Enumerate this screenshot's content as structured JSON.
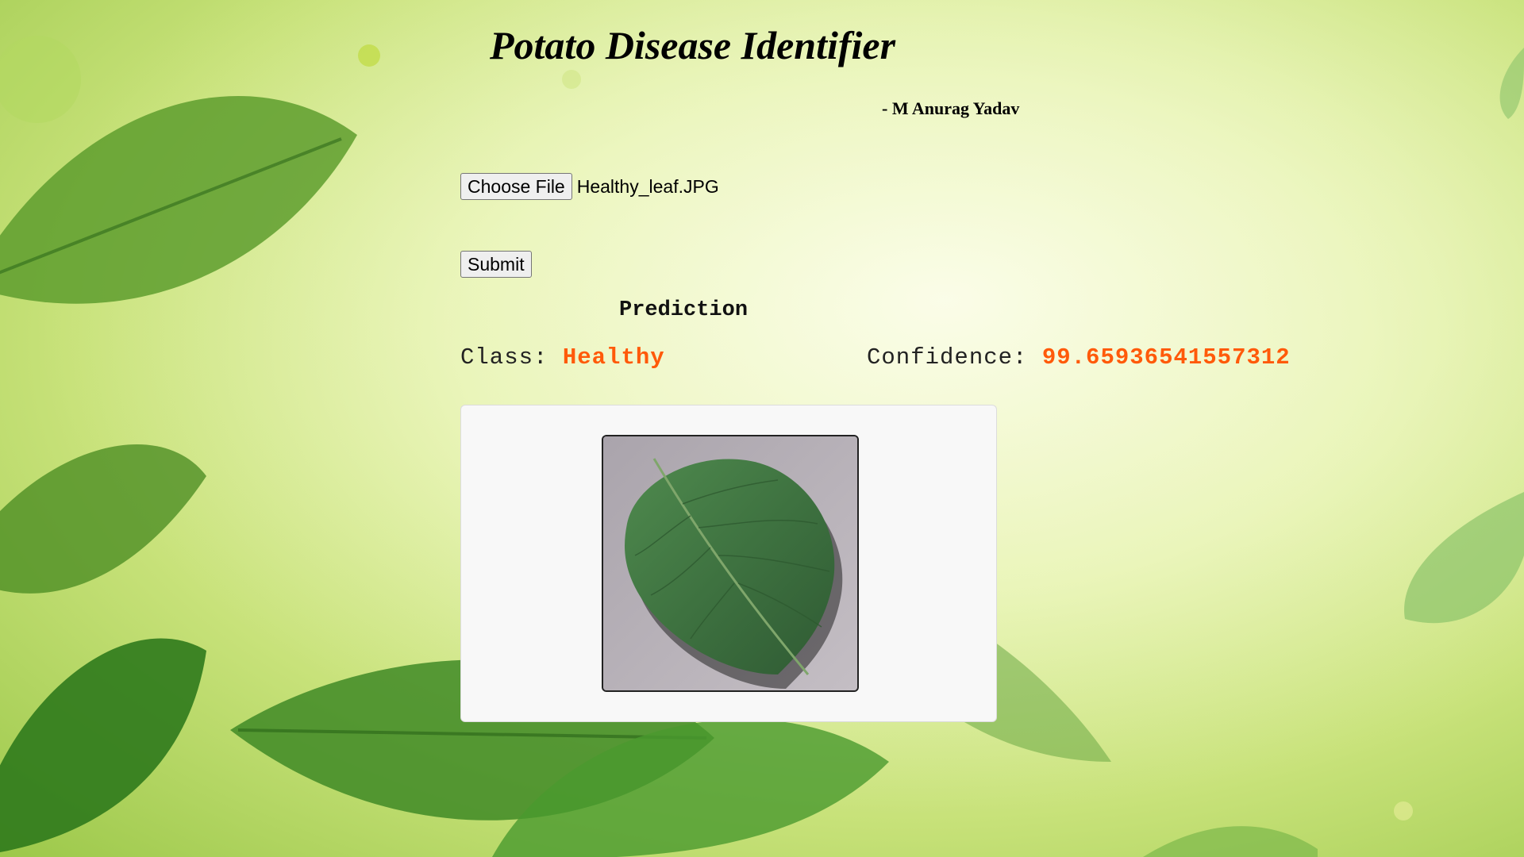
{
  "header": {
    "title": "Potato Disease Identifier",
    "author": "- M Anurag Yadav"
  },
  "upload": {
    "choose_file_label": "Choose File",
    "file_name": "Healthy_leaf.JPG",
    "submit_label": "Submit"
  },
  "prediction": {
    "heading": "Prediction",
    "class_label": "Class:",
    "class_value": "Healthy",
    "confidence_label": "Confidence:",
    "confidence_value": "99.65936541557312"
  },
  "colors": {
    "result_value": "#ff5a0a",
    "leaf_green": "#3f7a3f",
    "background_green": "#c8e27a"
  },
  "icons": {
    "uploaded_image": "potato-leaf-image"
  }
}
